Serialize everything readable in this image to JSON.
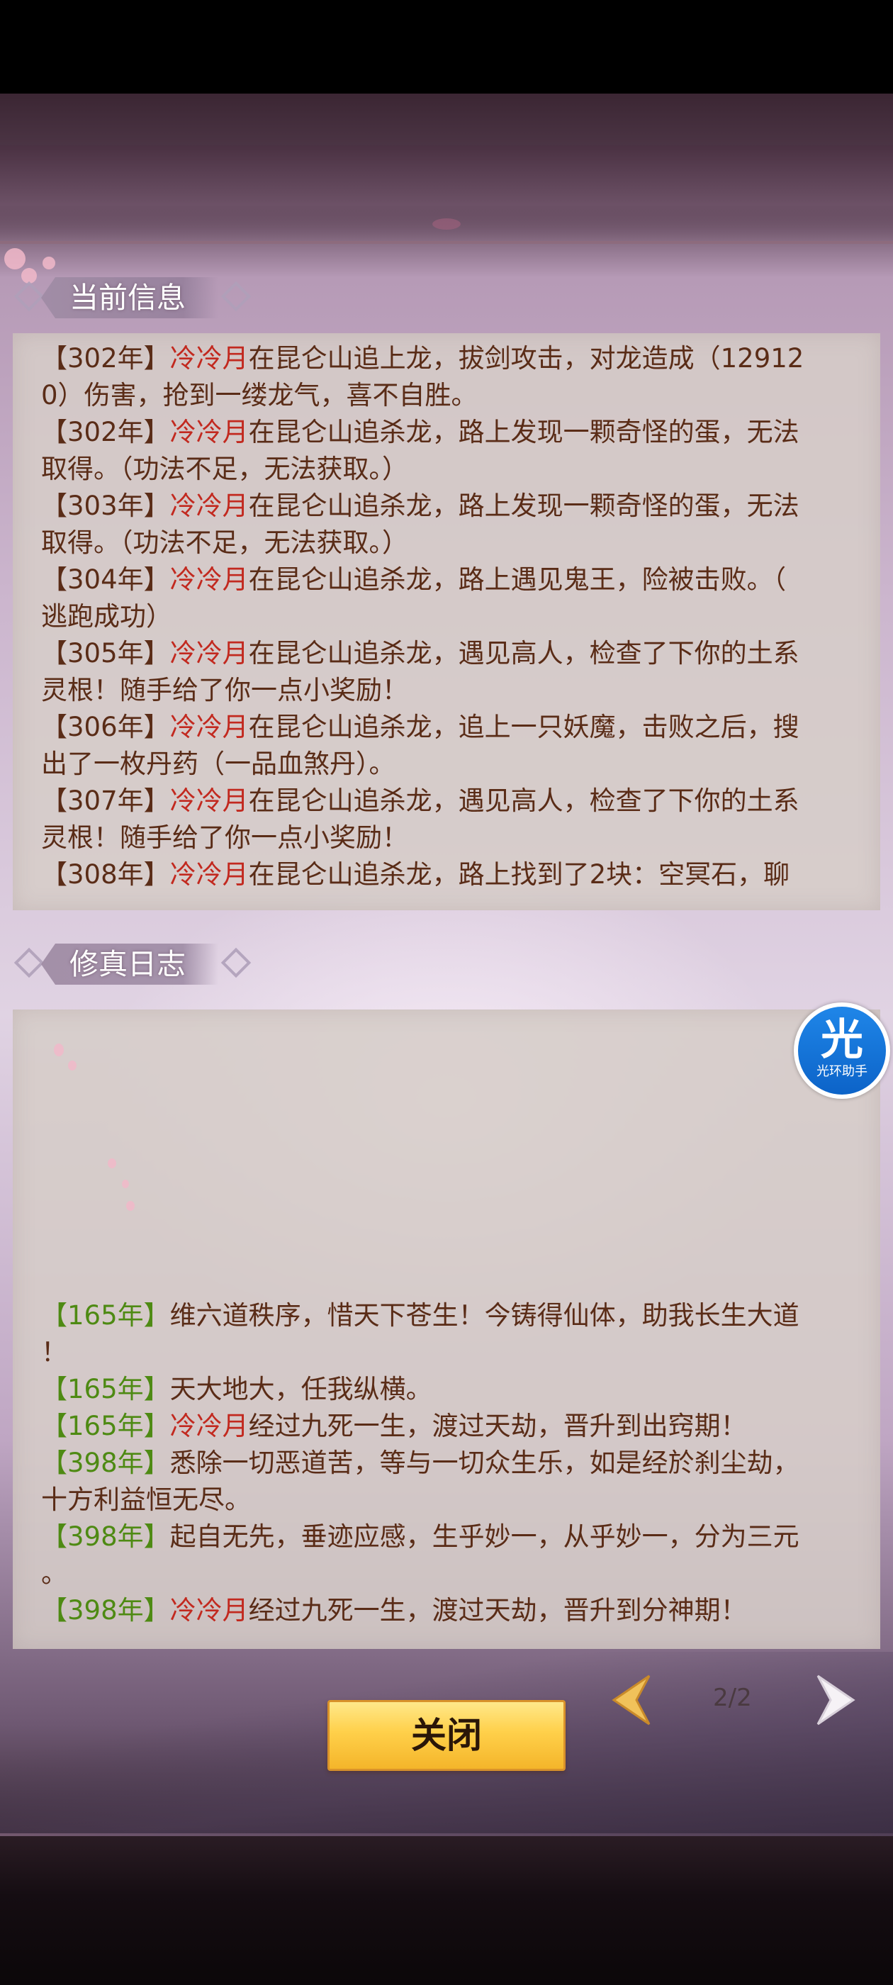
{
  "current_info": {
    "title": "当前信息",
    "lines": [
      {
        "year": "302年",
        "name": "冷冷月",
        "text": "在昆仑山追上龙，拔剑攻击，对龙造成（12912"
      },
      {
        "year": "",
        "name": "",
        "text": "0）伤害，抢到一缕龙气，喜不自胜。"
      },
      {
        "year": "302年",
        "name": "冷冷月",
        "text": "在昆仑山追杀龙，路上发现一颗奇怪的蛋，无法"
      },
      {
        "year": "",
        "name": "",
        "text": "取得。（功法不足，无法获取。）"
      },
      {
        "year": "303年",
        "name": "冷冷月",
        "text": "在昆仑山追杀龙，路上发现一颗奇怪的蛋，无法"
      },
      {
        "year": "",
        "name": "",
        "text": "取得。（功法不足，无法获取。）"
      },
      {
        "year": "304年",
        "name": "冷冷月",
        "text": "在昆仑山追杀龙，路上遇见鬼王，险被击败。（"
      },
      {
        "year": "",
        "name": "",
        "text": "逃跑成功）"
      },
      {
        "year": "305年",
        "name": "冷冷月",
        "text": "在昆仑山追杀龙，遇见高人，检查了下你的土系"
      },
      {
        "year": "",
        "name": "",
        "text": "灵根！随手给了你一点小奖励！"
      },
      {
        "year": "306年",
        "name": "冷冷月",
        "text": "在昆仑山追杀龙，追上一只妖魔，击败之后，搜"
      },
      {
        "year": "",
        "name": "",
        "text": "出了一枚丹药（一品血煞丹）。"
      },
      {
        "year": "307年",
        "name": "冷冷月",
        "text": "在昆仑山追杀龙，遇见高人，检查了下你的土系"
      },
      {
        "year": "",
        "name": "",
        "text": "灵根！随手给了你一点小奖励！"
      },
      {
        "year": "308年",
        "name": "冷冷月",
        "text": "在昆仑山追杀龙，路上找到了2块：空冥石，聊"
      }
    ]
  },
  "cultivation_log": {
    "title": "修真日志",
    "lines": [
      {
        "year": "165年",
        "name": "",
        "text": "维六道秩序，惜天下苍生！今铸得仙体，助我长生大道"
      },
      {
        "year": "",
        "name": "",
        "text": "！"
      },
      {
        "year": "165年",
        "name": "",
        "text": "天大地大，任我纵横。"
      },
      {
        "year": "165年",
        "name": "冷冷月",
        "text": "经过九死一生，渡过天劫，晋升到出窍期！"
      },
      {
        "year": "398年",
        "name": "",
        "text": "悉除一切恶道苦，等与一切众生乐，如是经於刹尘劫，"
      },
      {
        "year": "",
        "name": "",
        "text": "十方利益恒无尽。"
      },
      {
        "year": "398年",
        "name": "",
        "text": "起自无先，垂迹应感，生乎妙一，从乎妙一，分为三元"
      },
      {
        "year": "",
        "name": "",
        "text": "。"
      },
      {
        "year": "398年",
        "name": "冷冷月",
        "text": "经过九死一生，渡过天劫，晋升到分神期！"
      }
    ]
  },
  "assistant_badge": {
    "glyph": "光",
    "label": "光环助手"
  },
  "footer": {
    "close_label": "关闭",
    "page": "2/2"
  },
  "colors": {
    "name_red": "#c2291f",
    "year_green": "#4e8a13",
    "text_brown": "#5a2c17",
    "button_gold": "#ffd04a"
  }
}
